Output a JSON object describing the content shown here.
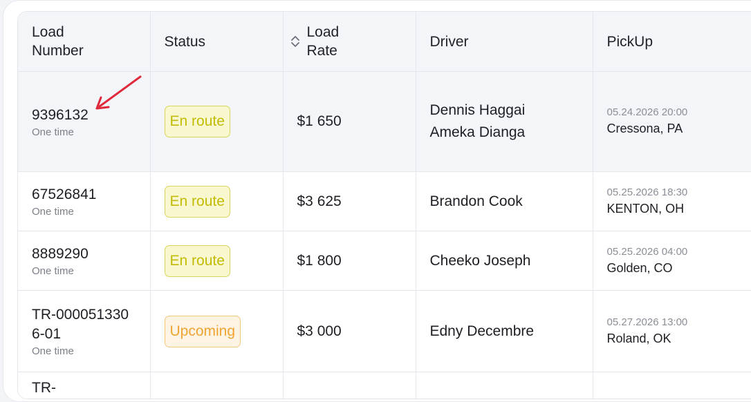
{
  "columns": {
    "load_number": "Load Number",
    "status": "Status",
    "load_rate": "Load Rate",
    "driver": "Driver",
    "pickup": "PickUp"
  },
  "rows": [
    {
      "load_number": "9396132",
      "type": "One time",
      "status": "En route",
      "rate": "$1 650",
      "driver1": "Dennis Haggai",
      "driver2": "Ameka Dianga",
      "pickup_date": "05.24.2026 20:00",
      "pickup_city": "Cressona, PA"
    },
    {
      "load_number": "67526841",
      "type": "One time",
      "status": "En route",
      "rate": "$3 625",
      "driver1": "Brandon Cook",
      "pickup_date": "05.25.2026 18:30",
      "pickup_city": "KENTON, OH"
    },
    {
      "load_number": "8889290",
      "type": "One time",
      "status": "En route",
      "rate": "$1 800",
      "driver1": "Cheeko Joseph",
      "pickup_date": "05.25.2026 04:00",
      "pickup_city": "Golden, CO"
    },
    {
      "load_number": "TR-0000513306-01",
      "type": "One time",
      "status": "Upcoming",
      "rate": "$3 000",
      "driver1": "Edny Decembre",
      "pickup_date": "05.27.2026 13:00",
      "pickup_city": "Roland, OK"
    },
    {
      "load_number": "TR-"
    }
  ],
  "colors": {
    "en_route": "#c2bb06",
    "upcoming": "#f0a432",
    "annotation_arrow": "#e0283b"
  }
}
